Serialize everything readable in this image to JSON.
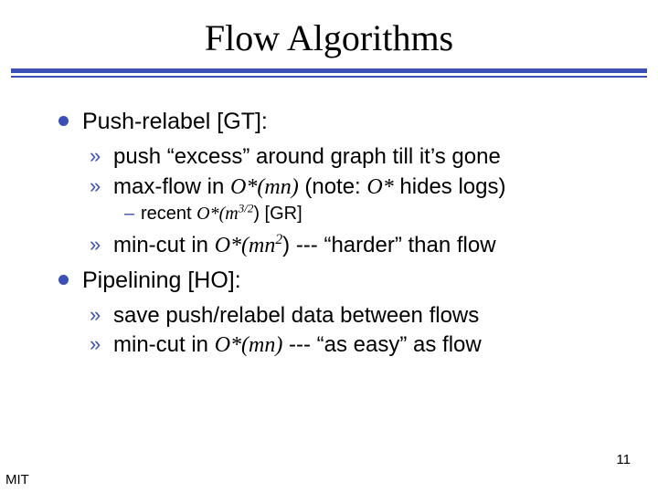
{
  "title": "Flow Algorithms",
  "bullets": {
    "b1": {
      "text": "Push-relabel [GT]:"
    },
    "b1a": {
      "text": "push “excess” around graph till it’s gone"
    },
    "b1b": {
      "pre": "max-flow in ",
      "math": "O*(mn)",
      "mid": " (note: ",
      "math2": "O*",
      "post": " hides logs)"
    },
    "b1b1": {
      "pre": "recent ",
      "math": "O*(m",
      "exp": "3/2",
      "post": ") [GR]"
    },
    "b1c": {
      "pre": "min-cut in ",
      "math": "O*(mn",
      "exp": "2",
      "post": ") --- “harder” than flow"
    },
    "b2": {
      "text": "Pipelining [HO]:"
    },
    "b2a": {
      "text": "save push/relabel data between flows"
    },
    "b2b": {
      "pre": "min-cut in ",
      "math": "O*(mn)",
      "post": " --- “as easy” as flow"
    }
  },
  "page_number": "11",
  "footer": "MIT"
}
